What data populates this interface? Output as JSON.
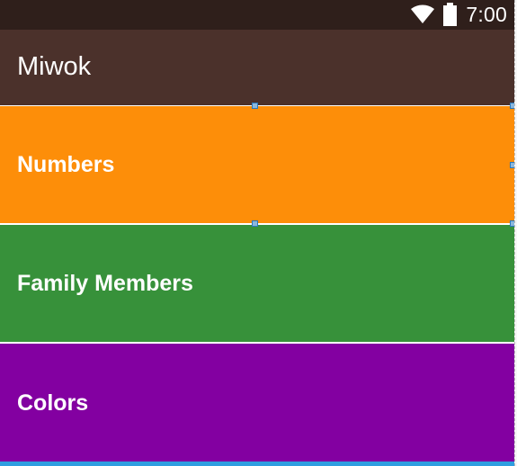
{
  "status_bar": {
    "time": "7:00",
    "wifi_icon": "wifi-icon",
    "battery_icon": "battery-icon"
  },
  "app_bar": {
    "title": "Miwok"
  },
  "categories": [
    {
      "label": "Numbers",
      "color": "#fd8e09"
    },
    {
      "label": "Family Members",
      "color": "#37913a"
    },
    {
      "label": "Colors",
      "color": "#8300a1"
    }
  ],
  "colors": {
    "status_bar": "#2f1f1b",
    "app_bar": "#4b312b",
    "selection_accent": "#2e9ee0"
  }
}
